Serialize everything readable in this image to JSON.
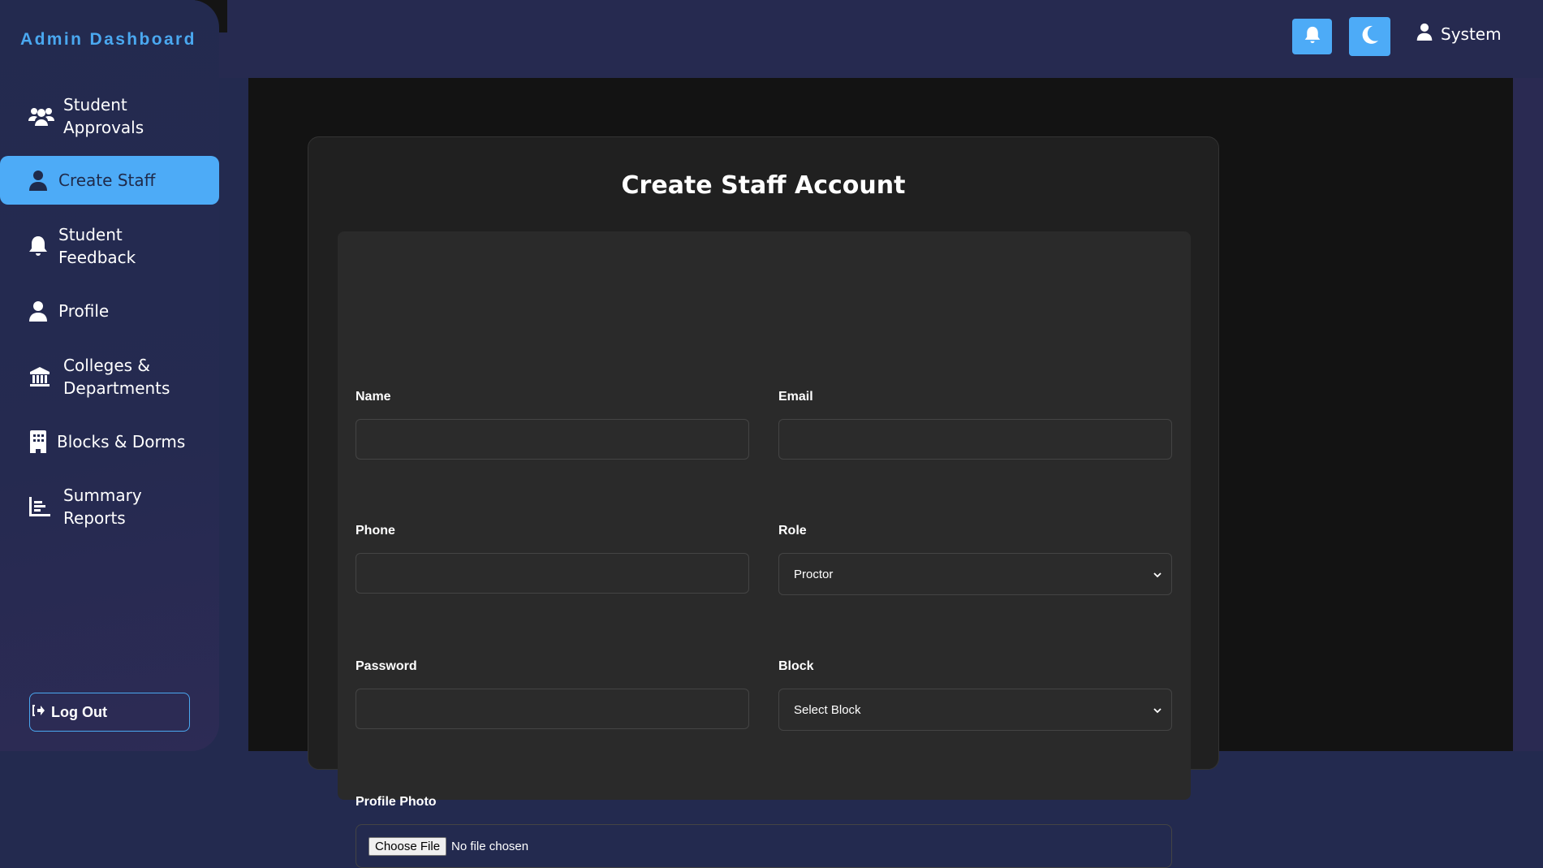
{
  "sidebar": {
    "brand": "Admin Dashboard",
    "items": [
      {
        "label": "Student Approvals",
        "icon": "users-icon"
      },
      {
        "label": "Create Staff",
        "icon": "user-icon",
        "active": true
      },
      {
        "label": "Student Feedback",
        "icon": "bell-icon"
      },
      {
        "label": "Profile",
        "icon": "user-icon"
      },
      {
        "label": "Colleges & Departments",
        "icon": "building-columns-icon"
      },
      {
        "label": "Blocks & Dorms",
        "icon": "building-icon"
      },
      {
        "label": "Summary Reports",
        "icon": "chart-bar-icon"
      }
    ],
    "logout": "Log Out"
  },
  "header": {
    "user": "System",
    "bell_icon": "bell-icon",
    "theme_icon": "moon-icon"
  },
  "form": {
    "title": "Create Staff Account",
    "name_label": "Name",
    "email_label": "Email",
    "phone_label": "Phone",
    "role_label": "Role",
    "role_value": "Proctor",
    "password_label": "Password",
    "block_label": "Block",
    "block_value": "Select Block",
    "photo_label": "Profile Photo",
    "file_button": "Choose File",
    "file_status": "No file chosen"
  },
  "colors": {
    "accent": "#4dabf7",
    "sidebar": "#232a4f",
    "main_bg": "#131313",
    "card": "#202020"
  }
}
